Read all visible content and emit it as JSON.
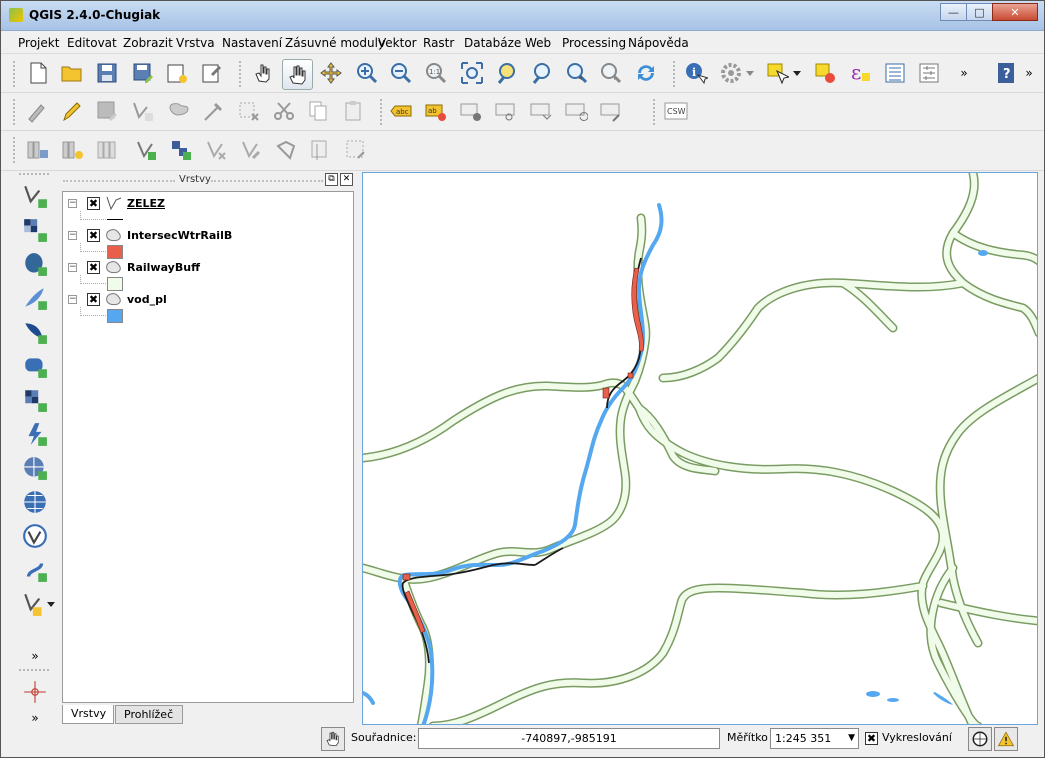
{
  "window": {
    "title": "QGIS 2.4.0-Chugiak",
    "minimize_glyph": "—",
    "maximize_glyph": "□",
    "close_glyph": "✕"
  },
  "menu": [
    {
      "label": "Projekt",
      "icon": "menu-projekt"
    },
    {
      "label": "Editovat"
    },
    {
      "label": "Zobrazit"
    },
    {
      "label": "Vrstva"
    },
    {
      "label": "Nastavení"
    },
    {
      "label": "Zásuvné moduly"
    },
    {
      "label": "Vektor"
    },
    {
      "label": "Rastr"
    },
    {
      "label": "Databáze"
    },
    {
      "label": "Web"
    },
    {
      "label": "Processing"
    },
    {
      "label": "Nápověda"
    }
  ],
  "toolbar": {
    "overflow_glyph": "»",
    "csw_label": "CSW",
    "abc_label": "abc",
    "ab_label": "ab",
    "scale_1_1": "1:1",
    "epsilon": "ε"
  },
  "left_toolbar": {
    "collapse_glyph": "»"
  },
  "layers_panel": {
    "title": "Vrstvy",
    "float_glyph": "⧉",
    "close_glyph": "✕",
    "layers": [
      {
        "name": "ZELEZ",
        "checked": "✖",
        "expander": "−",
        "type": "line",
        "color": "#000000",
        "current": true
      },
      {
        "name": "IntersecWtrRailB",
        "checked": "✖",
        "expander": "−",
        "type": "polygon",
        "color": "#e8604c"
      },
      {
        "name": "RailwayBuff",
        "checked": "✖",
        "expander": "−",
        "type": "polygon",
        "color": "#f0fbea"
      },
      {
        "name": "vod_pl",
        "checked": "✖",
        "expander": "−",
        "type": "polygon",
        "color": "#55a8f0"
      }
    ],
    "tabs": [
      {
        "label": "Vrstvy",
        "active": true
      },
      {
        "label": "Prohlížeč",
        "active": false
      }
    ]
  },
  "colors": {
    "river": "#55a8f0",
    "buffer_fill": "#f0fbea",
    "buffer_stroke": "#7a9c63",
    "railway": "#1a1a1a",
    "intersection": "#e8604c",
    "map_border": "#6aa6dd"
  },
  "statusbar": {
    "coords_label": "Souřadnice:",
    "coords_value": "-740897,-985191",
    "scale_label": "Měřítko",
    "scale_value": "1:245 351",
    "render_checked": "✖",
    "render_label": "Vykreslování"
  }
}
